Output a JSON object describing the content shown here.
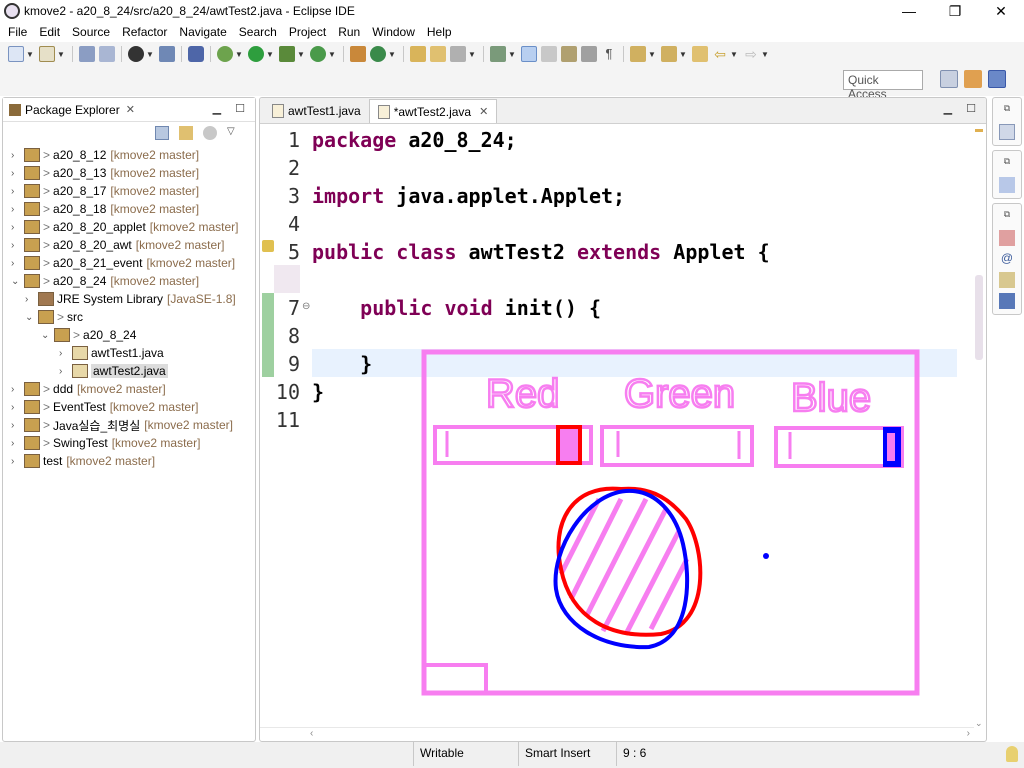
{
  "window": {
    "title": "kmove2 - a20_8_24/src/a20_8_24/awtTest2.java - Eclipse IDE",
    "minimize": "—",
    "maximize": "❐",
    "close": "✕"
  },
  "menu": [
    "File",
    "Edit",
    "Source",
    "Refactor",
    "Navigate",
    "Search",
    "Project",
    "Run",
    "Window",
    "Help"
  ],
  "quick_access": {
    "placeholder": "Quick Access"
  },
  "package_explorer": {
    "title": "Package Explorer",
    "close": "✕",
    "items": [
      {
        "decor": ">",
        "name": "a20_8_12",
        "repo": "[kmove2 master]"
      },
      {
        "decor": ">",
        "name": "a20_8_13",
        "repo": "[kmove2 master]"
      },
      {
        "decor": ">",
        "name": "a20_8_17",
        "repo": "[kmove2 master]"
      },
      {
        "decor": ">",
        "name": "a20_8_18",
        "repo": "[kmove2 master]"
      },
      {
        "decor": ">",
        "name": "a20_8_20_applet",
        "repo": "[kmove2 master]"
      },
      {
        "decor": ">",
        "name": "a20_8_20_awt",
        "repo": "[kmove2 master]"
      },
      {
        "decor": ">",
        "name": "a20_8_21_event",
        "repo": "[kmove2 master]"
      },
      {
        "decor": ">",
        "name": "a20_8_24",
        "repo": "[kmove2 master]"
      },
      {
        "decor": "",
        "name": "JRE System Library",
        "repo": "[JavaSE-1.8]"
      },
      {
        "decor": ">",
        "name": "src",
        "repo": ""
      },
      {
        "decor": ">",
        "name": "a20_8_24",
        "repo": ""
      },
      {
        "decor": "",
        "name": "awtTest1.java",
        "repo": ""
      },
      {
        "decor": "",
        "name": "awtTest2.java",
        "repo": ""
      },
      {
        "decor": ">",
        "name": "ddd",
        "repo": "[kmove2 master]"
      },
      {
        "decor": ">",
        "name": "EventTest",
        "repo": "[kmove2 master]"
      },
      {
        "decor": ">",
        "name": "Java실습_최명실",
        "repo": "[kmove2 master]"
      },
      {
        "decor": ">",
        "name": "SwingTest",
        "repo": "[kmove2 master]"
      },
      {
        "decor": "",
        "name": "test",
        "repo": "[kmove2 master]"
      }
    ]
  },
  "editor": {
    "tabs": [
      {
        "label": "awtTest1.java",
        "active": false
      },
      {
        "label": "*awtTest2.java",
        "active": true
      }
    ],
    "tab_close": "✕",
    "lines": [
      {
        "num": "1",
        "parts": [
          {
            "t": "package",
            "kw": true
          },
          {
            "t": " a20_8_24;",
            "kw": false
          }
        ]
      },
      {
        "num": "2",
        "parts": []
      },
      {
        "num": "3",
        "parts": [
          {
            "t": "import",
            "kw": true
          },
          {
            "t": " java.applet.Applet;",
            "kw": false
          }
        ]
      },
      {
        "num": "4",
        "parts": []
      },
      {
        "num": "5",
        "parts": [
          {
            "t": "public",
            "kw": true
          },
          {
            "t": " ",
            "kw": false
          },
          {
            "t": "class",
            "kw": true
          },
          {
            "t": " awtTest2 ",
            "kw": false
          },
          {
            "t": "extends",
            "kw": true
          },
          {
            "t": " Applet {",
            "kw": false
          }
        ]
      },
      {
        "num": "6",
        "parts": []
      },
      {
        "num": "7",
        "parts": [
          {
            "t": "    ",
            "kw": false
          },
          {
            "t": "public",
            "kw": true
          },
          {
            "t": " ",
            "kw": false
          },
          {
            "t": "void",
            "kw": true
          },
          {
            "t": " init() {",
            "kw": false
          }
        ]
      },
      {
        "num": "8",
        "parts": []
      },
      {
        "num": "9",
        "parts": [
          {
            "t": "    }",
            "kw": false
          }
        ]
      },
      {
        "num": "10",
        "parts": [
          {
            "t": "}",
            "kw": false
          }
        ]
      },
      {
        "num": "11",
        "parts": []
      }
    ]
  },
  "applet_drawing": {
    "labels": [
      "Red",
      "Green",
      "Blue"
    ],
    "colors": {
      "frame": "#f77ef0",
      "red": "#ff0000",
      "blue": "#0000ff"
    }
  },
  "status": {
    "writable": "Writable",
    "insert_mode": "Smart Insert",
    "position": "9 : 6"
  }
}
